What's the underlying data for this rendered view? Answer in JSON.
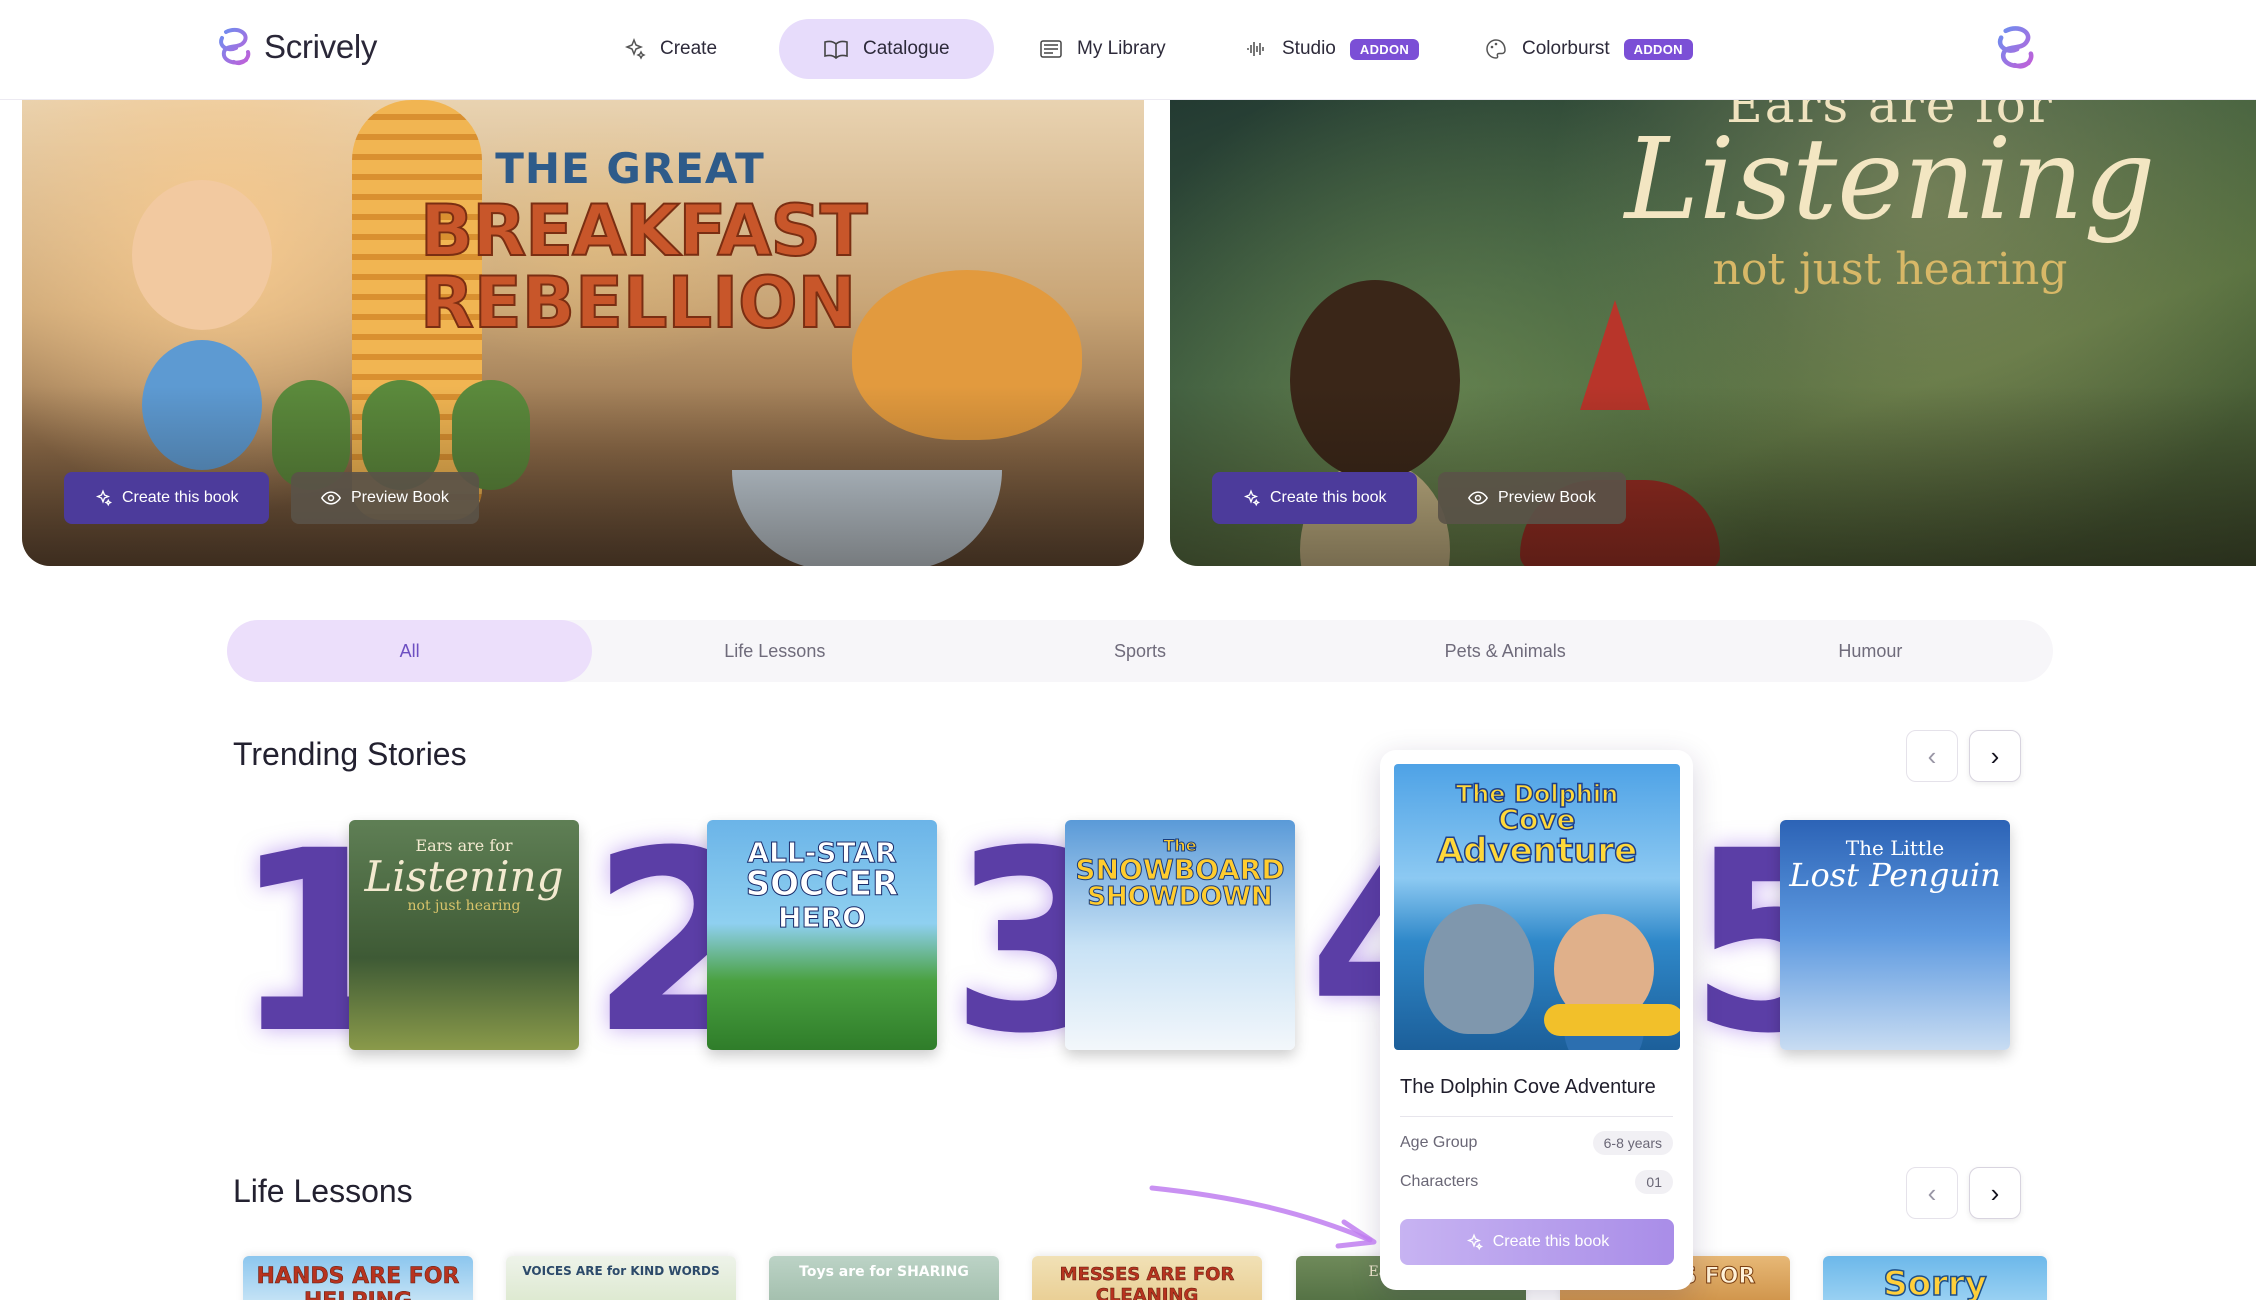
{
  "brand": {
    "name": "Scrively"
  },
  "nav": {
    "items": [
      {
        "label": "Create",
        "icon": "sparkles-icon"
      },
      {
        "label": "Catalogue",
        "icon": "open-book-icon"
      },
      {
        "label": "My Library",
        "icon": "library-icon"
      },
      {
        "label": "Studio",
        "icon": "audio-wave-icon",
        "badge": "ADDON"
      },
      {
        "label": "Colorburst",
        "icon": "palette-icon",
        "badge": "ADDON"
      }
    ]
  },
  "hero": {
    "slides": [
      {
        "title_line1": "THE GREAT",
        "title_line2": "BREAKFAST",
        "title_line3": "REBELLION",
        "create_label": "Create this book",
        "preview_label": "Preview Book"
      },
      {
        "title_line1": "Ears are for",
        "title_line2": "Listening",
        "title_line3": "not just hearing",
        "create_label": "Create this book",
        "preview_label": "Preview Book"
      }
    ]
  },
  "tabs": [
    "All",
    "Life Lessons",
    "Sports",
    "Pets & Animals",
    "Humour"
  ],
  "trending": {
    "title": "Trending Stories",
    "books": [
      {
        "rank": "1",
        "cover_line1": "Ears are for",
        "cover_line2": "Listening",
        "cover_line3": "not just hearing"
      },
      {
        "rank": "2",
        "cover_line1": "ALL-STAR",
        "cover_line2": "SOCCER",
        "cover_line3": "HERO"
      },
      {
        "rank": "3",
        "cover_line1": "The",
        "cover_line2": "SNOWBOARD",
        "cover_line3": "SHOWDOWN"
      },
      {
        "rank": "4",
        "cover_line1": "The Dolphin",
        "cover_line2": "Cove",
        "cover_line3": "Adventure"
      },
      {
        "rank": "5",
        "cover_line1": "The Little",
        "cover_line2": "Lost Penguin",
        "cover_line3": ""
      }
    ],
    "popup": {
      "title": "The Dolphin Cove Adventure",
      "age_label": "Age Group",
      "age_value": "6-8 years",
      "characters_label": "Characters",
      "characters_value": "01",
      "create_label": "Create this book"
    }
  },
  "life_lessons": {
    "title": "Life Lessons",
    "covers": [
      "HANDS ARE FOR HELPING",
      "VOICES ARE for KIND WORDS",
      "Toys are for SHARING",
      "MESSES ARE FOR CLEANING",
      "Ears are for",
      "FOOD IS FOR",
      "Sorry"
    ]
  },
  "colors": {
    "accent": "#5b3ea6",
    "active_tab_bg": "#ecdffb",
    "badge": "#7b4fd6",
    "hero_button": "#4c3b9b"
  }
}
